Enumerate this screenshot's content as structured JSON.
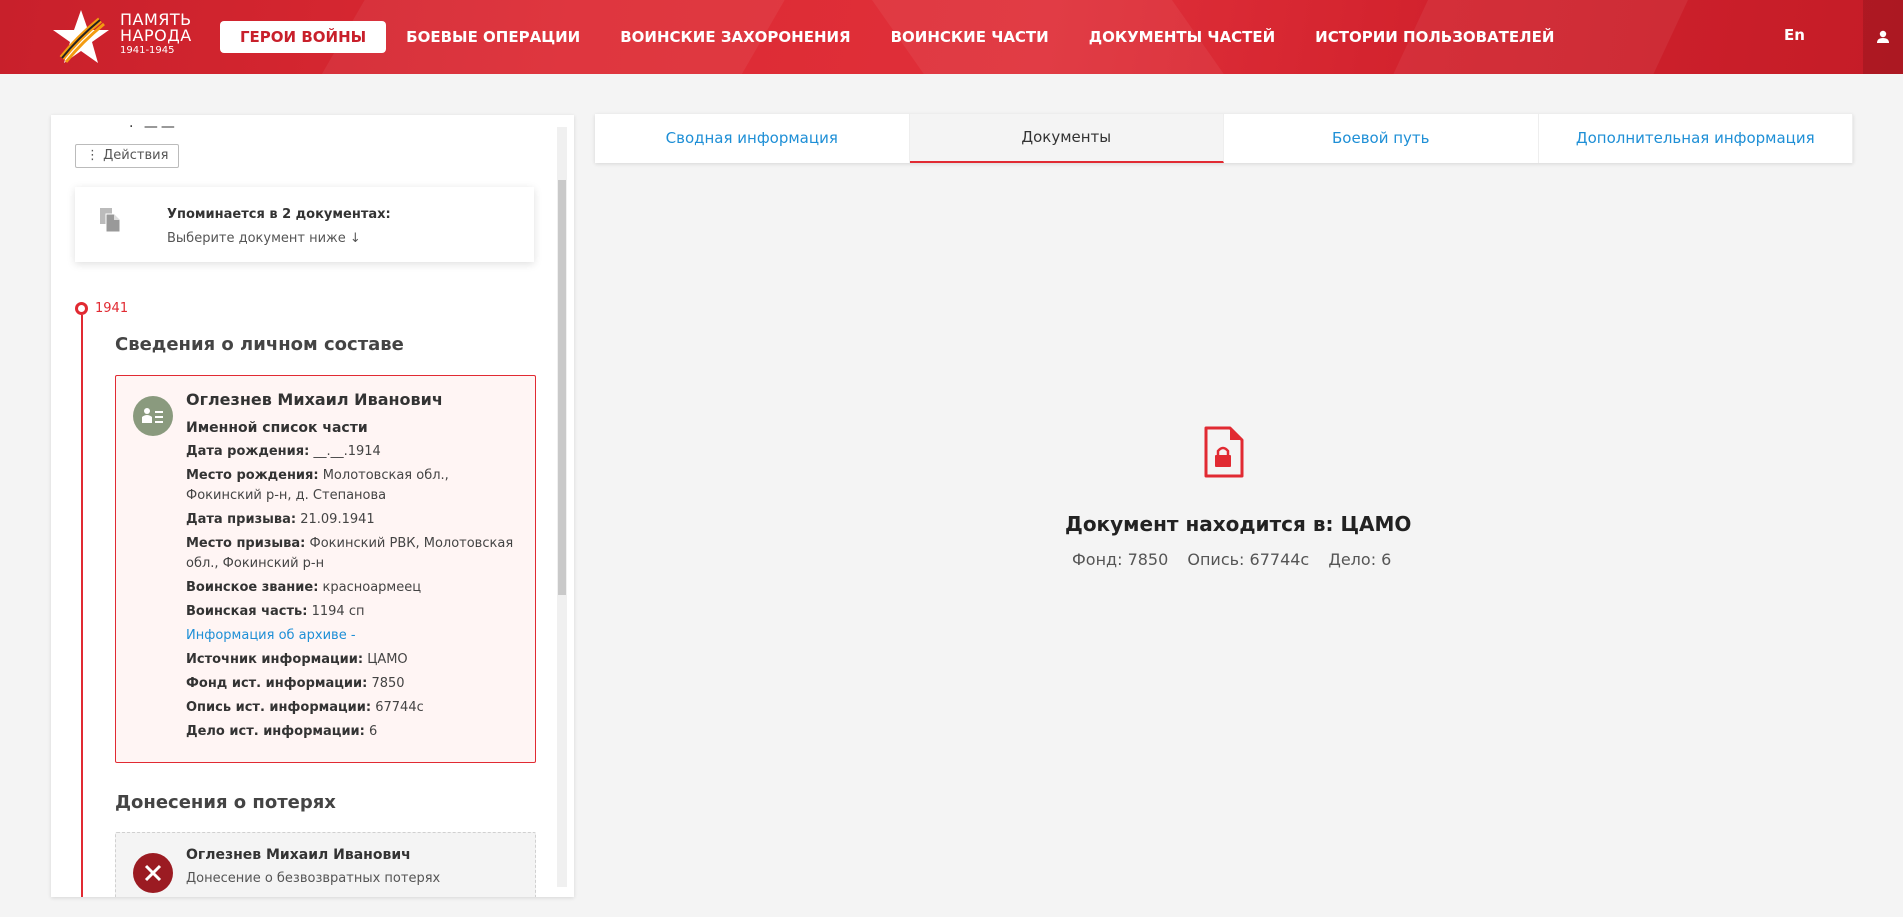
{
  "header": {
    "logo": {
      "line1": "ПАМЯТЬ",
      "line2": "НАРОДА",
      "years": "1941-1945"
    },
    "nav": [
      {
        "label": "ГЕРОИ ВОЙНЫ",
        "active": true
      },
      {
        "label": "БОЕВЫЕ ОПЕРАЦИИ"
      },
      {
        "label": "ВОИНСКИЕ ЗАХОРОНЕНИЯ"
      },
      {
        "label": "ВОИНСКИЕ ЧАСТИ"
      },
      {
        "label": "ДОКУМЕНТЫ ЧАСТЕЙ"
      },
      {
        "label": "ИСТОРИИ ПОЛЬЗОВАТЕЛЕЙ"
      }
    ],
    "lang": "En",
    "user_icon": "user-icon"
  },
  "left": {
    "top_cut": "·  ——",
    "actions_label": "⋮ Действия",
    "mention": {
      "title": "Упоминается в 2 документах:",
      "hint": "Выберите документ ниже ↓"
    },
    "year": "1941",
    "section1": "Сведения о личном составе",
    "record": {
      "name": "Оглезнев Михаил Иванович",
      "type": "Именной список части",
      "fields": [
        {
          "label": "Дата рождения:",
          "value": "__.__.1914"
        },
        {
          "label": "Место рождения:",
          "value": "Молотовская обл., Фокинский р-н, д. Степанова"
        },
        {
          "label": "Дата призыва:",
          "value": "21.09.1941"
        },
        {
          "label": "Место призыва:",
          "value": "Фокинский РВК, Молотовская обл., Фокинский р-н"
        },
        {
          "label": "Воинское звание:",
          "value": "красноармеец"
        },
        {
          "label": "Воинская часть:",
          "value": "1194 сп"
        }
      ],
      "archive_link": "Информация об архиве -",
      "source_fields": [
        {
          "label": "Источник информации:",
          "value": "ЦАМО"
        },
        {
          "label": "Фонд ист. информации:",
          "value": "7850"
        },
        {
          "label": "Опись ист. информации:",
          "value": "67744с"
        },
        {
          "label": "Дело ист. информации:",
          "value": "6"
        }
      ]
    },
    "section2": "Донесения о потерях",
    "loss": {
      "name": "Оглезнев Михаил Иванович",
      "type": "Донесение о безвозвратных потерях"
    }
  },
  "tabs": [
    {
      "label": "Сводная информация"
    },
    {
      "label": "Документы",
      "active": true
    },
    {
      "label": "Боевой путь"
    },
    {
      "label": "Дополнительная информация"
    }
  ],
  "document": {
    "location": "Документ находится в: ЦАМО",
    "fond": "Фонд: 7850",
    "opis": "Опись: 67744с",
    "delo": "Дело: 6"
  },
  "colors": {
    "accent": "#e12a32",
    "link": "#1e8fd6",
    "header": "#d8262f"
  }
}
